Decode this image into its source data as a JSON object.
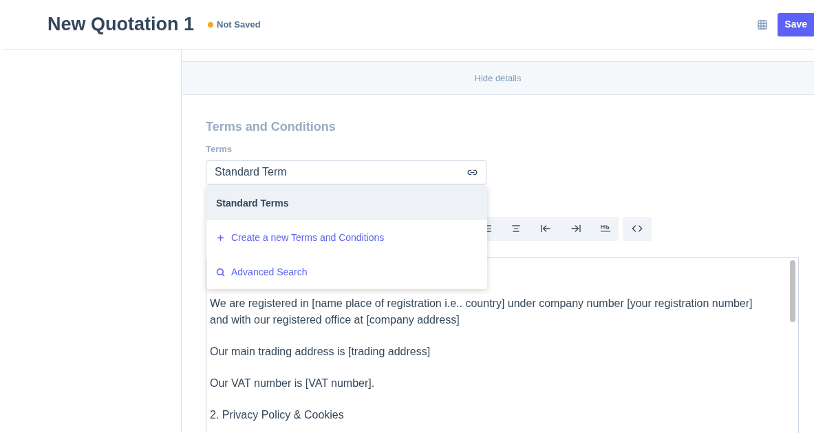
{
  "header": {
    "title": "New Quotation 1",
    "status": {
      "label": "Not Saved",
      "color": "#f5a623"
    },
    "save_button": "Save"
  },
  "details_toggle": "Hide details",
  "section": {
    "title": "Terms and Conditions",
    "field_label": "Terms",
    "field_value": "Standard Term"
  },
  "dropdown": {
    "options": [
      {
        "kind": "option",
        "label": "Standard Terms",
        "selected": true
      },
      {
        "kind": "create",
        "label": "Create a new Terms and Conditions",
        "selected": false
      },
      {
        "kind": "search",
        "label": "Advanced Search",
        "selected": false
      }
    ]
  },
  "editor": {
    "paragraphs": [
      "We are registered in [name place of registration i.e.. country] under company number [your registration number] and with our registered office at [company address]",
      "Our main trading address is [trading address]",
      "Our VAT number is [VAT number].",
      "2. Privacy Policy & Cookies"
    ]
  }
}
